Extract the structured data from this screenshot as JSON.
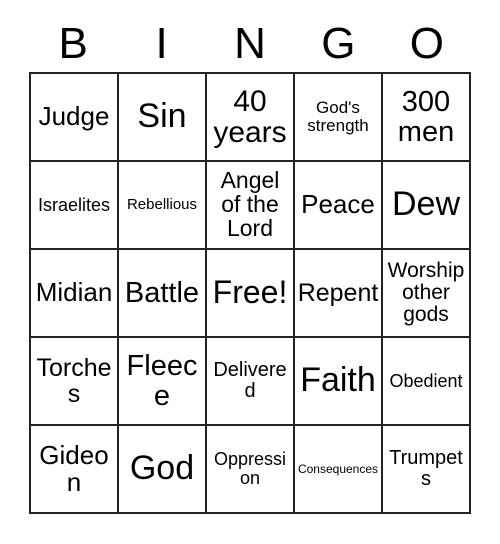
{
  "card": {
    "header_letters": [
      "B",
      "I",
      "N",
      "G",
      "O"
    ],
    "free_space_label": "Free!",
    "grid": [
      [
        {
          "label": "Judge",
          "size": "fs-26"
        },
        {
          "label": "Sin",
          "size": "fs-34"
        },
        {
          "label": "40 years",
          "size": "fs-30"
        },
        {
          "label": "God's strength",
          "size": "fs-17"
        },
        {
          "label": "300 men",
          "size": "fs-29"
        }
      ],
      [
        {
          "label": "Israelites",
          "size": "fs-18"
        },
        {
          "label": "Rebellious",
          "size": "fs-15"
        },
        {
          "label": "Angel of the Lord",
          "size": "fs-23"
        },
        {
          "label": "Peace",
          "size": "fs-26"
        },
        {
          "label": "Dew",
          "size": "fs-34"
        }
      ],
      [
        {
          "label": "Midian",
          "size": "fs-26"
        },
        {
          "label": "Battle",
          "size": "fs-29"
        },
        {
          "label": "Free!",
          "size": "fs-32"
        },
        {
          "label": "Repent",
          "size": "fs-25"
        },
        {
          "label": "Worship other gods",
          "size": "fs-21"
        }
      ],
      [
        {
          "label": "Torches",
          "size": "fs-25"
        },
        {
          "label": "Fleece",
          "size": "fs-29"
        },
        {
          "label": "Delivered",
          "size": "fs-20"
        },
        {
          "label": "Faith",
          "size": "fs-34"
        },
        {
          "label": "Obedient",
          "size": "fs-18"
        }
      ],
      [
        {
          "label": "Gideon",
          "size": "fs-26"
        },
        {
          "label": "God",
          "size": "fs-34"
        },
        {
          "label": "Oppression",
          "size": "fs-18"
        },
        {
          "label": "Consequences",
          "size": "fs-12"
        },
        {
          "label": "Trumpets",
          "size": "fs-20"
        }
      ]
    ]
  },
  "colors": {
    "border": "#222222",
    "text": "#000000",
    "background": "#ffffff"
  }
}
